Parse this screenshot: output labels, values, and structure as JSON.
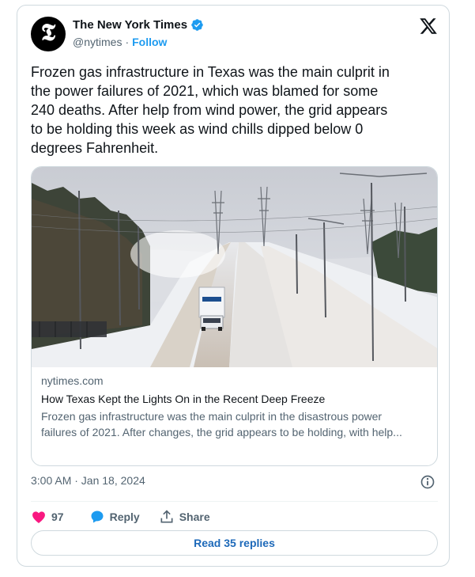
{
  "author": {
    "name": "The New York Times",
    "handle": "@nytimes",
    "separator": "·",
    "follow_label": "Follow",
    "avatar_glyph": "𝕿",
    "verified_icon": "verified-badge-icon",
    "platform_icon": "x-logo-icon"
  },
  "tweet": {
    "text": "Frozen gas infrastructure in Texas was the main culprit in\nthe power failures of 2021, which was blamed for some\n240 deaths. After help from wind power, the grid appears\nto be holding this week as wind chills dipped below 0\ndegrees Fahrenheit."
  },
  "link_card": {
    "image_desc_icon": "photo-icy-highway-truck",
    "domain": "nytimes.com",
    "title": "How Texas Kept the Lights On in the Recent Deep Freeze",
    "description": "Frozen gas infrastructure was the main culprit in the disastrous power\nfailures of 2021. After changes, the grid appears to be holding, with help..."
  },
  "meta": {
    "timestamp": "3:00 AM · Jan 18, 2024",
    "info_icon": "info-icon"
  },
  "actions": {
    "like_count": "97",
    "reply_label": "Reply",
    "share_label": "Share"
  },
  "read_replies_label": "Read 35 replies",
  "colors": {
    "accent": "#1d9bf0",
    "like": "#f91880",
    "text": "#0f1419",
    "muted": "#536471",
    "border": "#cfd9de"
  }
}
